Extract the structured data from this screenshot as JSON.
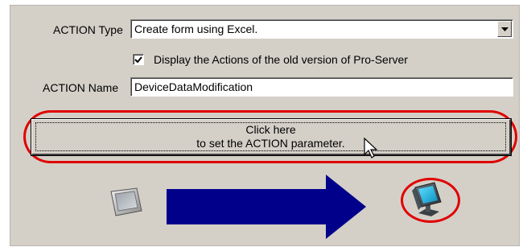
{
  "action_type": {
    "label": "ACTION Type",
    "value": "Create form using Excel."
  },
  "old_version_checkbox": {
    "label": "Display the Actions of the old version of Pro-Server",
    "checked": true
  },
  "action_name": {
    "label": "ACTION Name",
    "value": "DeviceDataModification"
  },
  "set_parameter_button": {
    "line1": "Click here",
    "line2": "to set the ACTION parameter."
  },
  "colors": {
    "panel": "#d4d0c8",
    "arrow": "#00008b",
    "highlight": "#e00000"
  },
  "icons": [
    "panel-device-icon",
    "arrow-right-icon",
    "pc-monitor-icon",
    "mouse-pointer-icon",
    "dropdown-arrow-icon",
    "checkmark-icon"
  ]
}
